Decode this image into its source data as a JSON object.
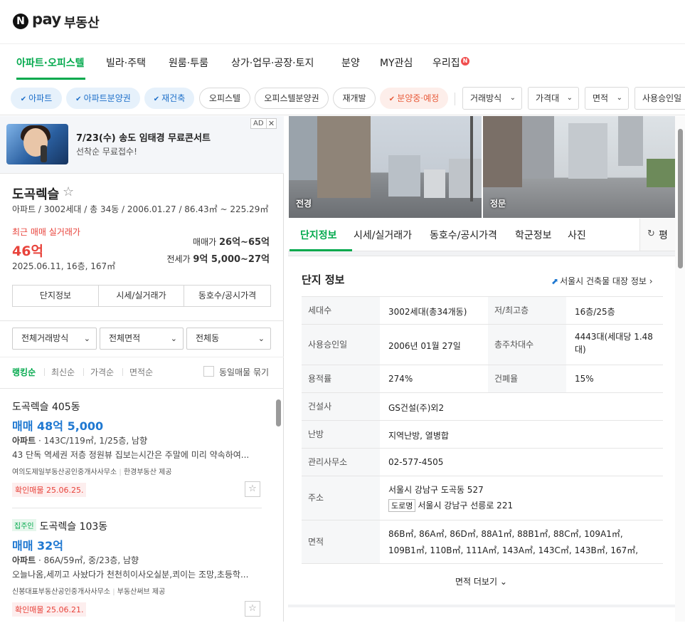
{
  "header": {
    "logo_mark": "N",
    "logo_pay": "pay",
    "title": "부동산"
  },
  "nav": {
    "tabs": [
      {
        "label": "아파트·오피스텔"
      },
      {
        "label": "빌라·주택"
      },
      {
        "label": "원룸·투룸"
      },
      {
        "label": "상가·업무·공장·토지"
      },
      {
        "label": "분양"
      },
      {
        "label": "MY관심"
      },
      {
        "label": "우리집"
      }
    ],
    "new_badge": "N",
    "accent_color": "#03a94d"
  },
  "filters": {
    "chips": [
      {
        "label": "아파트",
        "check": "✔"
      },
      {
        "label": "아파트분양권",
        "check": "✔"
      },
      {
        "label": "재건축",
        "check": "✔"
      },
      {
        "label": "오피스텔"
      },
      {
        "label": "오피스텔분양권"
      },
      {
        "label": "재개발"
      },
      {
        "label": "분양중·예정",
        "check": "✔"
      }
    ],
    "dropdowns": [
      {
        "label": "거래방식"
      },
      {
        "label": "가격대"
      },
      {
        "label": "면적"
      },
      {
        "label": "사용승인일"
      }
    ],
    "chevron": "⌄"
  },
  "ad": {
    "title": "7/23(수) 송도 임태경 무료콘서트",
    "subtitle": "선착순 무료접수!",
    "label": "AD",
    "close": "✕"
  },
  "complex": {
    "name": "도곡렉슬",
    "star": "☆",
    "meta": "아파트 / 3002세대 / 총 34동 / 2006.01.27 / 86.43㎡ ~ 225.29㎡",
    "recent_label": "최근 매매 실거래가",
    "recent_price": "46억",
    "recent_date": "2025.06.11, 16층, 167㎡",
    "sale_label": "매매가",
    "sale_value": "26억~65억",
    "jeonse_label": "전세가",
    "jeonse_value": "9억 5,000~27억",
    "buttons": [
      "단지정보",
      "시세/실거래가",
      "동호수/공시가격"
    ]
  },
  "selects": {
    "deal": "전체거래방식",
    "area": "전체면적",
    "dong": "전체동",
    "chevron": "⌄"
  },
  "sort": {
    "items": [
      "랭킹순",
      "최신순",
      "가격순",
      "면적순"
    ],
    "group_label": "동일매물 묶기"
  },
  "listings": [
    {
      "badge": "",
      "title": "도곡렉슬 405동",
      "price": "매매 48억 5,000",
      "type": "아파트",
      "spec": " · 143C/119㎡, 1/25층, 남향",
      "desc": "43 단독 역세권 저층 정원뷰 집보는시간은 주말에 미리 약속하여...",
      "agent": "여의도제일부동산공인중개사사무소",
      "provider": "한경부동산 제공",
      "verified": "확인매물 25.06.25.",
      "star": "☆"
    },
    {
      "badge": "집주인",
      "title": "도곡렉슬 103동",
      "price": "매매 32억",
      "type": "아파트",
      "spec": " · 86A/59㎡, 중/23층, 남향",
      "desc": "오늘나옴,세끼고 사놨다가 천천히이사오실분,쾨이는 조망,초등학...",
      "agent": "신봉대표부동산공인중개사사무소",
      "provider": "부동산써브 제공",
      "verified": "확인매물 25.06.21.",
      "star": "☆"
    }
  ],
  "photos": [
    {
      "label": "전경"
    },
    {
      "label": "정문"
    }
  ],
  "detail_tabs": {
    "items": [
      "단지정보",
      "시세/실거래가",
      "동호수/공시가격",
      "학군정보",
      "사진"
    ],
    "refresh_icon": "↻",
    "refresh_label": "평"
  },
  "info": {
    "title": "단지 정보",
    "link": "서울시 건축물 대장 정보",
    "link_icon": "⬈",
    "link_chevron": "›",
    "rows": [
      {
        "label": "세대수",
        "value": "3002세대(총34개동)",
        "label2": "저/최고층",
        "value2": "16층/25층"
      },
      {
        "label": "사용승인일",
        "value": "2006년 01월 27일",
        "label2": "총주차대수",
        "value2": "4443대(세대당 1.48대)"
      },
      {
        "label": "용적률",
        "value": "274%",
        "label2": "건폐율",
        "value2": "15%"
      },
      {
        "label": "건설사",
        "value": "GS건설(주)외2"
      },
      {
        "label": "난방",
        "value": "지역난방, 열병합"
      },
      {
        "label": "관리사무소",
        "value": "02-577-4505"
      },
      {
        "label": "주소",
        "value": "서울시 강남구 도곡동 527",
        "road_badge": "도로명",
        "road_value": "서울시 강남구 선릉로 221"
      },
      {
        "label": "면적",
        "value": "86B㎡, 86A㎡, 86D㎡, 88A1㎡, 88B1㎡, 88C㎡, 109A1㎡,",
        "value_line2": "109B1㎡, 110B㎡, 111A㎡, 143A㎡, 143C㎡, 143B㎡, 167㎡,"
      }
    ],
    "more": "면적 더보기",
    "more_chevron": "⌄"
  }
}
